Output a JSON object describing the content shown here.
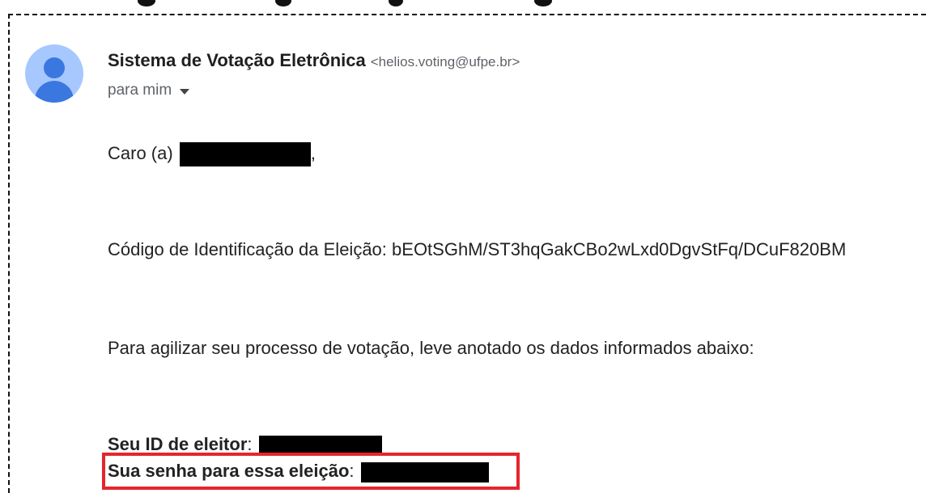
{
  "email": {
    "sender_name": "Sistema de Votação Eletrônica",
    "sender_email": "<helios.voting@ufpe.br>",
    "recipient_label": "para mim",
    "greeting_prefix": "Caro (a)",
    "greeting_suffix": ",",
    "election_code_label": "Código de Identificação da Eleição:",
    "election_code_value": "bEOtSGhM/ST3hqGakCBo2wLxd0DgvStFq/DCuF820BM",
    "instruction": "Para agilizar seu processo de votação, leve anotado os dados informados abaixo:",
    "voter_id_label": "Seu ID de eleitor",
    "password_label": "Sua senha para essa eleição",
    "label_separator": ":"
  },
  "icons": {
    "avatar": "person-avatar-icon",
    "recipient_toggle": "caret-down-icon"
  },
  "colors": {
    "avatar_bg": "#a6c8ff",
    "avatar_fg": "#3a78e0",
    "highlight": "#e5252d",
    "redaction": "#000000"
  }
}
